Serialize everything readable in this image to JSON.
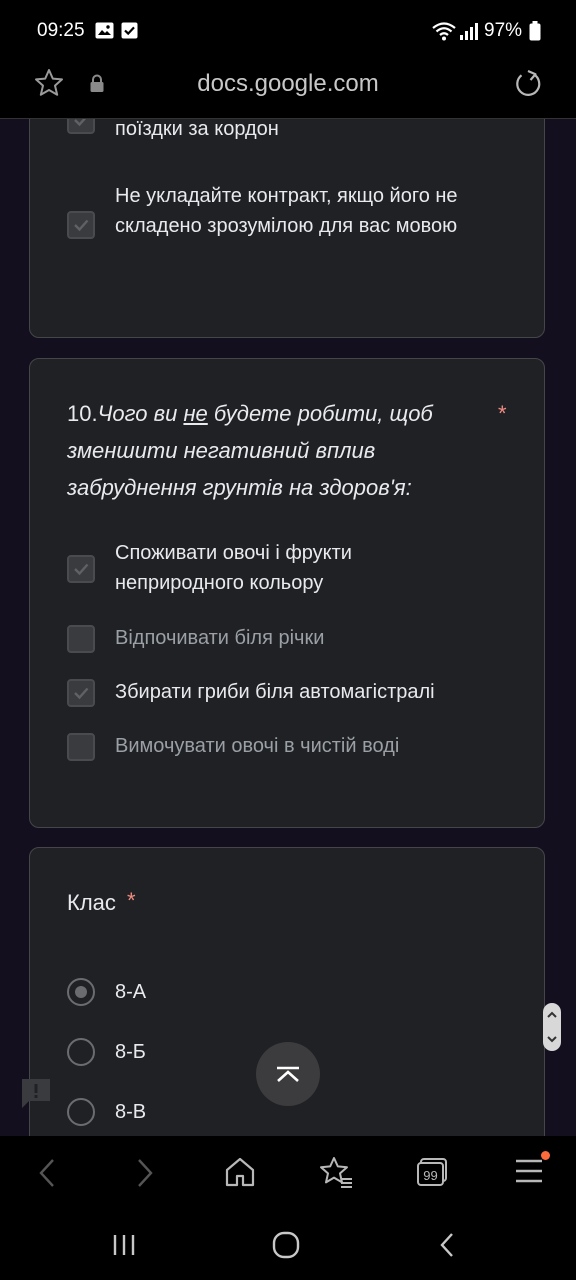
{
  "status_bar": {
    "time": "09:25",
    "battery": "97%",
    "icons": [
      "gallery-icon",
      "check-notification-icon",
      "wifi-icon",
      "signal-icon",
      "battery-icon"
    ]
  },
  "url_bar": {
    "url": "docs.google.com",
    "icons": [
      "star-icon",
      "lock-icon",
      "reload-icon"
    ]
  },
  "prev_question": {
    "cut_option_line": "поїздки за кордон",
    "options": [
      {
        "label": "Не укладайте контракт, якщо його не складено зрозумілою для вас мовою",
        "checked": true
      }
    ]
  },
  "question_10": {
    "number": "10.",
    "title_before": "Чого ви ",
    "title_underlined": "не",
    "title_after": " будете робити, щоб зменшити негативний вплив забруднення грунтів на здоров'я:",
    "required_mark": "*",
    "options": [
      {
        "label": "Споживати овочі і фрукти неприродного кольору",
        "checked": true
      },
      {
        "label": "Відпочивати біля річки",
        "checked": false
      },
      {
        "label": "Збирати гриби біля автомагістралі",
        "checked": true
      },
      {
        "label": "Вимочувати овочі в чистій воді",
        "checked": false
      }
    ]
  },
  "class_question": {
    "title": "Клас",
    "required_mark": "*",
    "options": [
      {
        "label": "8-А",
        "selected": true
      },
      {
        "label": "8-Б",
        "selected": false
      },
      {
        "label": "8-В",
        "selected": false
      }
    ]
  },
  "colors": {
    "background": "#140f1f",
    "card": "#202124",
    "required": "#f28b82",
    "notification_dot": "#ff6a3d"
  },
  "browser_nav": [
    "back-icon",
    "forward-icon",
    "home-icon",
    "bookmarks-icon",
    "tabs-icon",
    "menu-icon"
  ],
  "system_nav": [
    "recents-icon",
    "home-circle-icon",
    "system-back-icon"
  ]
}
